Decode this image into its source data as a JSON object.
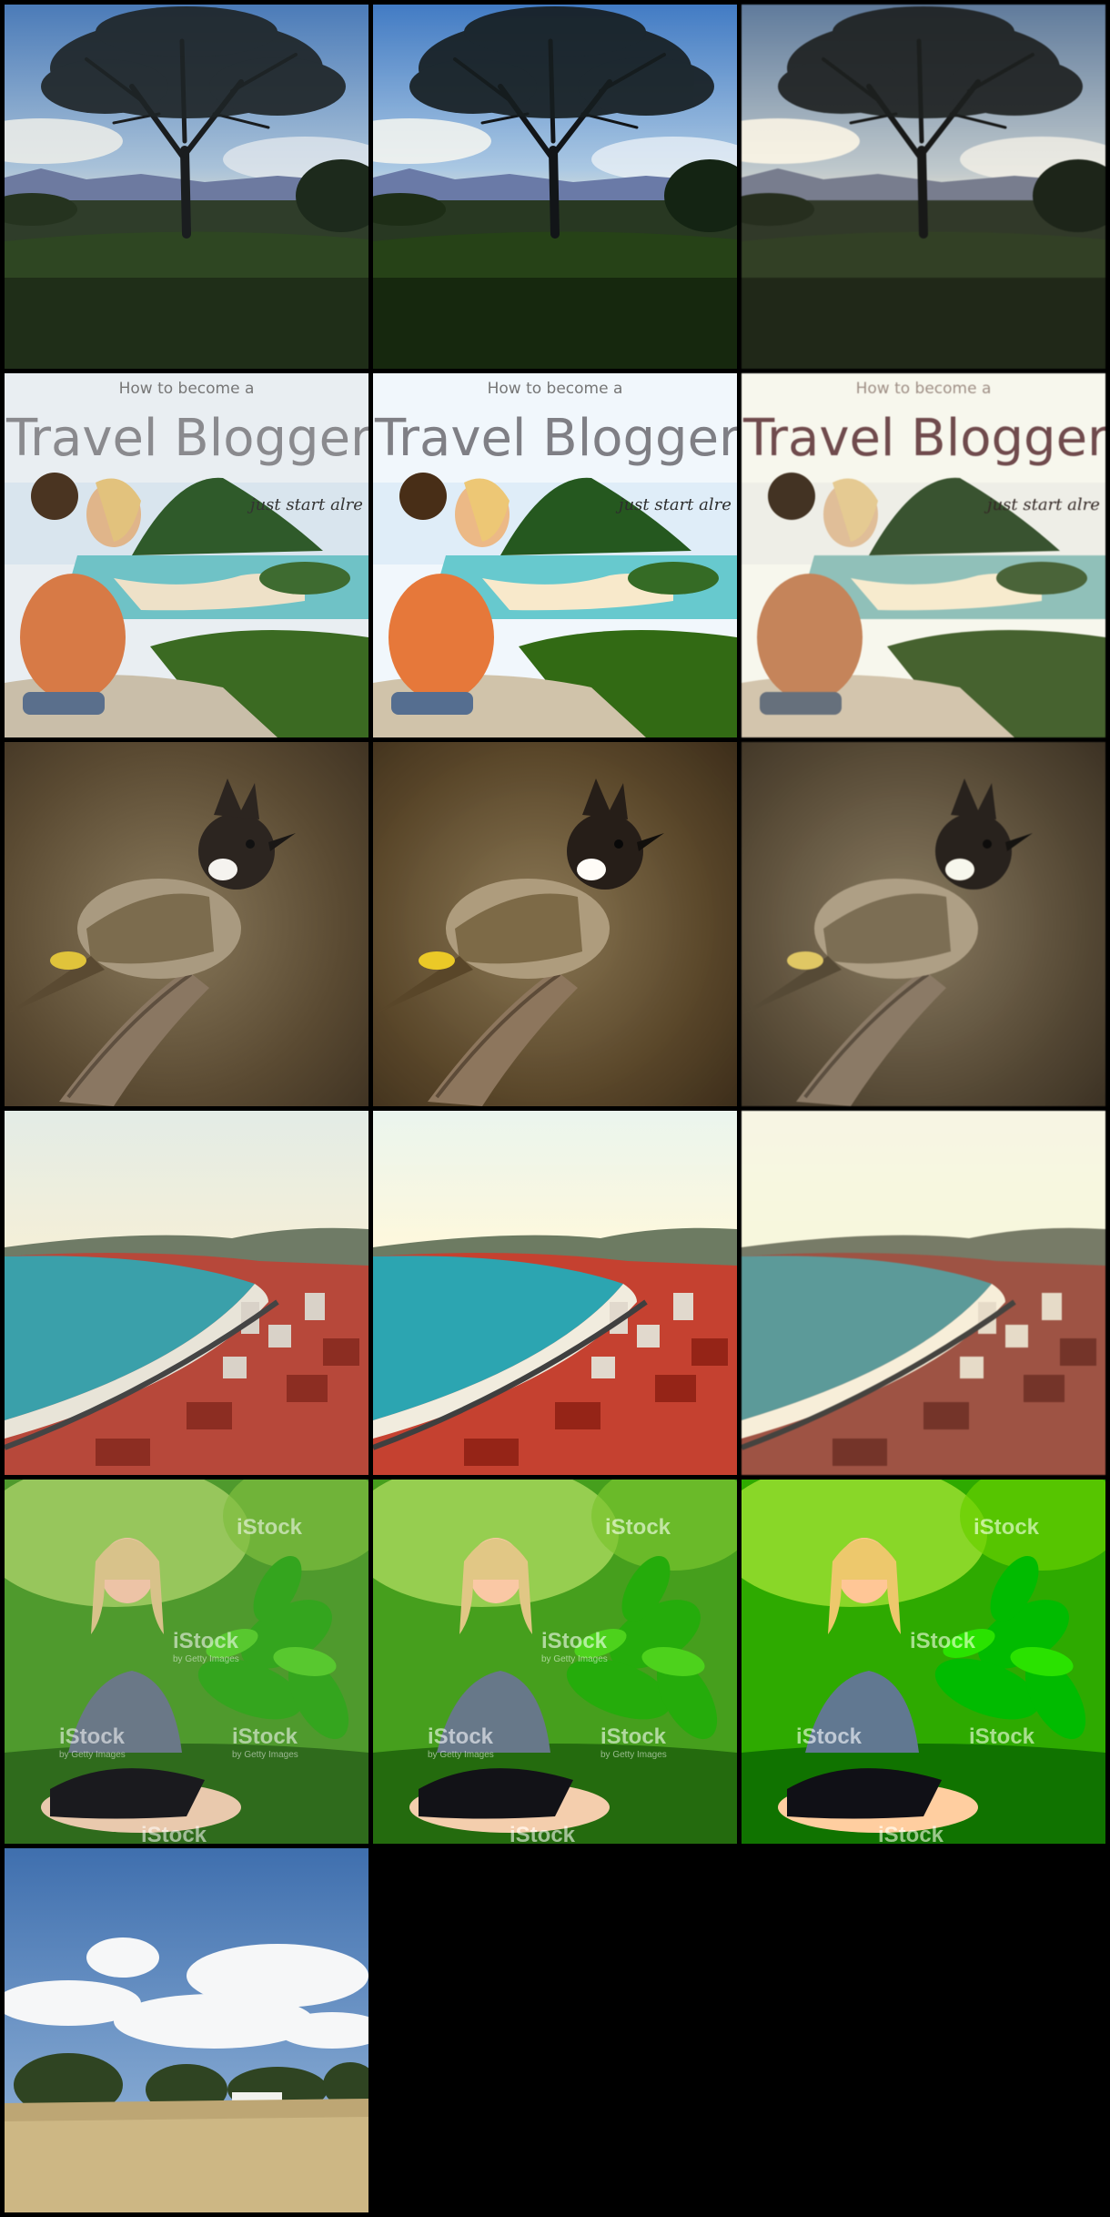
{
  "travel_poster": {
    "kicker": "How to become a",
    "title": "Travel Blogger",
    "tagline": "just start alre"
  },
  "watermark": {
    "brand": "iStock",
    "byline": "by Getty Images"
  }
}
